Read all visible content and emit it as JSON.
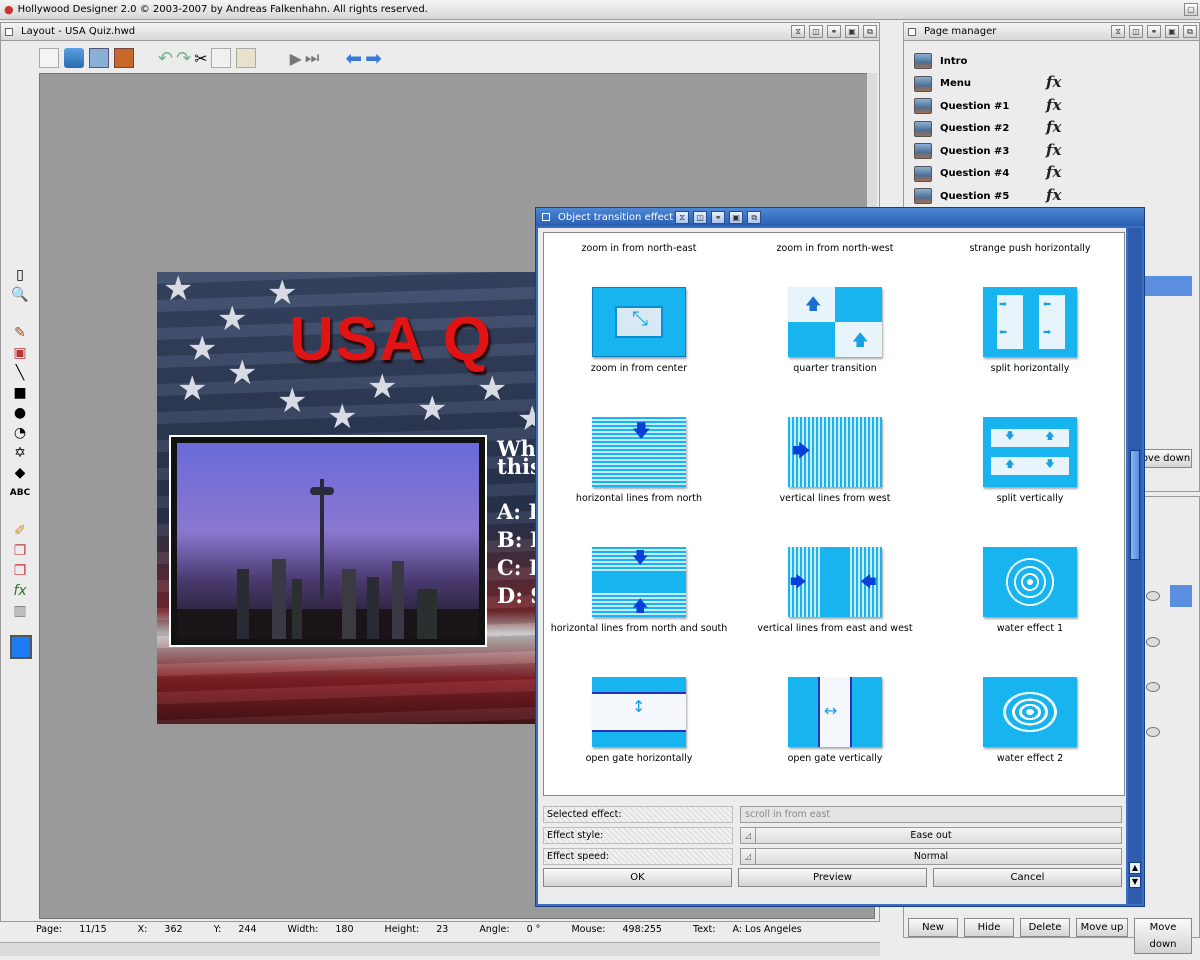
{
  "app_title": "Hollywood Designer 2.0 © 2003-2007 by Andreas Falkenhahn. All rights reserved.",
  "layout_window": {
    "title": "Layout - USA Quiz.hwd"
  },
  "slide": {
    "heading": "USA Q",
    "question_visible": [
      "Wh",
      "this"
    ],
    "answers_visible": [
      "A: L",
      "B: H",
      "C: D",
      "D: S"
    ]
  },
  "page_manager": {
    "title": "Page manager",
    "pages": [
      "Intro",
      "Menu",
      "Question #1",
      "Question #2",
      "Question #3",
      "Question #4",
      "Question #5"
    ],
    "move_down_partial": "ove down",
    "buttons": {
      "new": "New",
      "hide": "Hide",
      "delete": "Delete",
      "move_up": "Move up",
      "move_down": "Move down"
    }
  },
  "dialog": {
    "title": "Object transition effect",
    "top_labels": [
      "zoom in from north-east",
      "zoom in from north-west",
      "strange push horizontally"
    ],
    "effects": [
      "zoom in from center",
      "quarter transition",
      "split horizontally",
      "horizontal lines from north",
      "vertical lines from west",
      "split vertically",
      "horizontal lines from north and south",
      "vertical lines from east and west",
      "water effect 1",
      "open gate horizontally",
      "open gate vertically",
      "water effect 2"
    ],
    "selected_label": "Selected effect:",
    "selected_value": "scroll in from east",
    "style_label": "Effect style:",
    "style_value": "Ease out",
    "speed_label": "Effect speed:",
    "speed_value": "Normal",
    "ok": "OK",
    "preview": "Preview",
    "cancel": "Cancel"
  },
  "status": {
    "page_label": "Page:",
    "page_value": "11/15",
    "x_label": "X:",
    "x_value": "362",
    "y_label": "Y:",
    "y_value": "244",
    "width_label": "Width:",
    "width_value": "180",
    "height_label": "Height:",
    "height_value": "23",
    "angle_label": "Angle:",
    "angle_value": "0 °",
    "mouse_label": "Mouse:",
    "mouse_value": "498:255",
    "text_label": "Text:",
    "text_value": "A: Los Angeles"
  },
  "colors": {
    "accent": "#2a5db0",
    "thumb_blue": "#18b4f0",
    "arrow_blue": "#0a3fd8",
    "heading_red": "#e01414"
  }
}
